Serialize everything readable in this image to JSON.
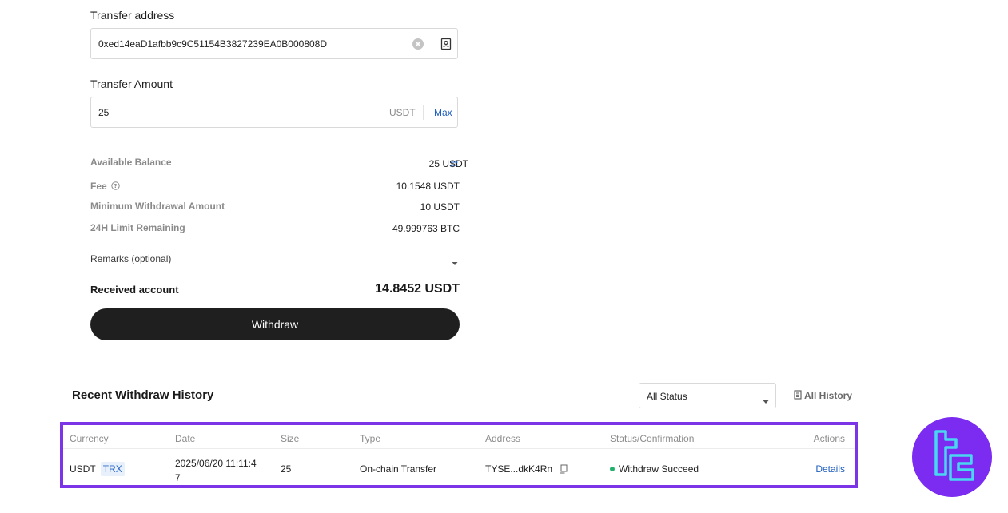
{
  "form": {
    "address_label": "Transfer address",
    "address_value": "0xed14eaD1afbb9c9C51154B3827239EA0B000808D",
    "amount_label": "Transfer Amount",
    "amount_value": "25",
    "amount_unit": "USDT",
    "max_label": "Max"
  },
  "info": {
    "available_label": "Available Balance",
    "available_value": "25 USDT",
    "fee_label": "Fee",
    "fee_value": "10.1548 USDT",
    "min_label": "Minimum Withdrawal Amount",
    "min_value": "10 USDT",
    "limit_label": "24H Limit Remaining",
    "limit_value": "49.999763 BTC",
    "remarks_label": "Remarks (optional)",
    "received_label": "Received account",
    "received_value": "14.8452 USDT"
  },
  "withdraw_button": "Withdraw",
  "history": {
    "title": "Recent Withdraw History",
    "status_filter": "All Status",
    "all_history": "All History",
    "columns": [
      "Currency",
      "Date",
      "Size",
      "Type",
      "Address",
      "Status/Confirmation",
      "Actions"
    ],
    "rows": [
      {
        "currency": "USDT",
        "network": "TRX",
        "date_line1": "2025/06/20 11:11:4",
        "date_line2": "7",
        "size": "25",
        "type": "On-chain Transfer",
        "address": "TYSE...dkK4Rn",
        "status": "Withdraw Succeed",
        "action": "Details"
      }
    ]
  },
  "colors": {
    "accent_purple": "#7b35e6",
    "link_blue": "#1f5fbf",
    "success_green": "#20b26c"
  }
}
